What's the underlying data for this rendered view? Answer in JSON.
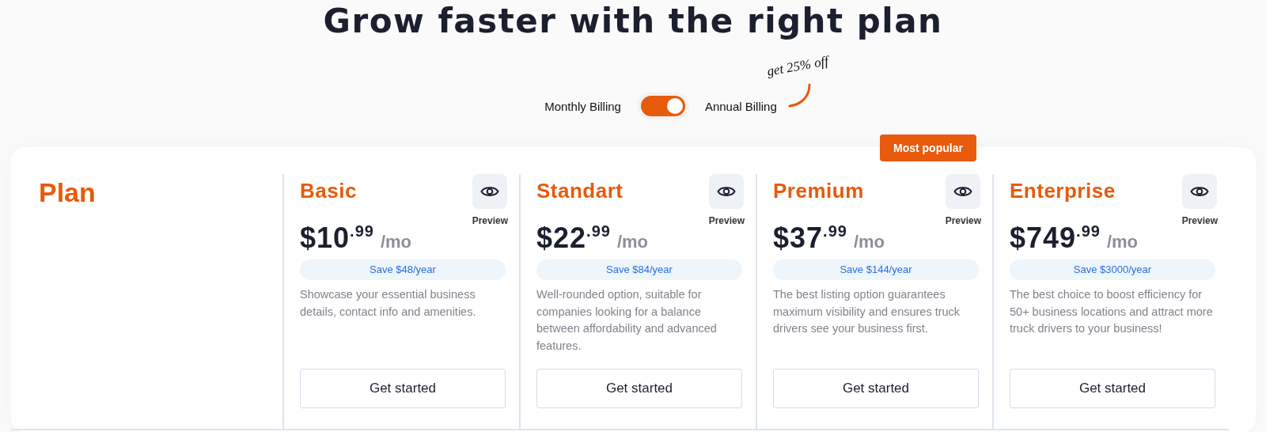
{
  "heading": "Grow faster with the right plan",
  "billing": {
    "monthly_label": "Monthly Billing",
    "annual_label": "Annual Billing",
    "annual_on": true,
    "promo": "get 25% off"
  },
  "table": {
    "row_label": "Plan",
    "plans": [
      {
        "name": "Basic",
        "preview": "Preview",
        "price": "$10$^{.99}$",
        "period": "/mo",
        "saving": "Save $48/year",
        "description": "Showcase your essential business details, contact info and amenities.",
        "button": "Get started"
      },
      {
        "name": "Standart",
        "preview": "Preview",
        "price": "$22$^{.99}$",
        "period": "/mo",
        "saving": "Save $84/year",
        "description": "Well-rounded option, suitable for companies looking for a balance between affordability and advanced features.",
        "button": "Get started"
      },
      {
        "name": "Premium",
        "badge": "Most popular",
        "preview": "Preview",
        "price": "$37$^{.99}$",
        "period": "/mo",
        "saving": "Save $144/year",
        "description": "The best listing option guarantees maximum visibility and ensures truck drivers see your business first.",
        "button": "Get started"
      },
      {
        "name": "Enterprise",
        "preview": "Preview",
        "price": "$749$^{.99}$",
        "period": "/mo",
        "saving": "Save $3000/year",
        "description": "The best choice to boost efficiency for 50+ business locations and attract more truck drivers to your business!",
        "button": "Get started"
      }
    ]
  }
}
